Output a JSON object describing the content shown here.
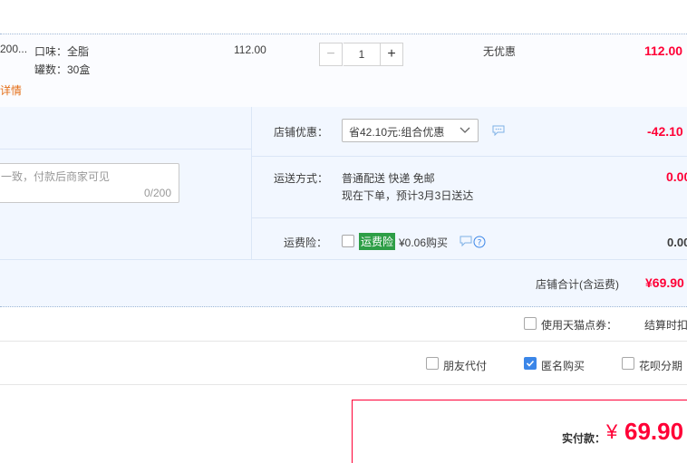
{
  "item": {
    "name_fragment": "200...",
    "details_link": "详情",
    "attr_flavor": "口味：全脂",
    "attr_count": "罐数：30盒",
    "unit_price": "112.00",
    "quantity": "1",
    "promo": "无优惠",
    "subtotal": "112.00",
    "minus_symbol": "−",
    "plus_symbol": "+"
  },
  "message": {
    "placeholder": "一致，付款后商家可见",
    "counter": "0/200"
  },
  "shop_discount": {
    "label": "店铺优惠：",
    "selected": "省42.10元:组合优惠",
    "amount": "-42.10"
  },
  "delivery": {
    "label": "运送方式：",
    "line1": "普通配送 快递 免邮",
    "line2": "现在下单，预计3月3日送达",
    "amount": "0.00"
  },
  "insurance": {
    "label": "运费险：",
    "badge": "运费险",
    "price_text": "¥0.06购买",
    "amount": "0.00"
  },
  "shop_total": {
    "label": "店铺合计(含运费)",
    "amount": "¥69.90"
  },
  "points": {
    "label": "使用天猫点券：",
    "settle_text": "结算时扣"
  },
  "options": {
    "friend_pay": "朋友代付",
    "anonymous": "匿名购买",
    "huabei": "花呗分期"
  },
  "payment": {
    "label": "实付款：",
    "currency": "¥",
    "amount": "69.90"
  },
  "colors": {
    "accent_red": "#ff0036",
    "check_blue": "#3b86e8",
    "badge_green": "#2e9e46",
    "link_orange": "#e46e18"
  }
}
